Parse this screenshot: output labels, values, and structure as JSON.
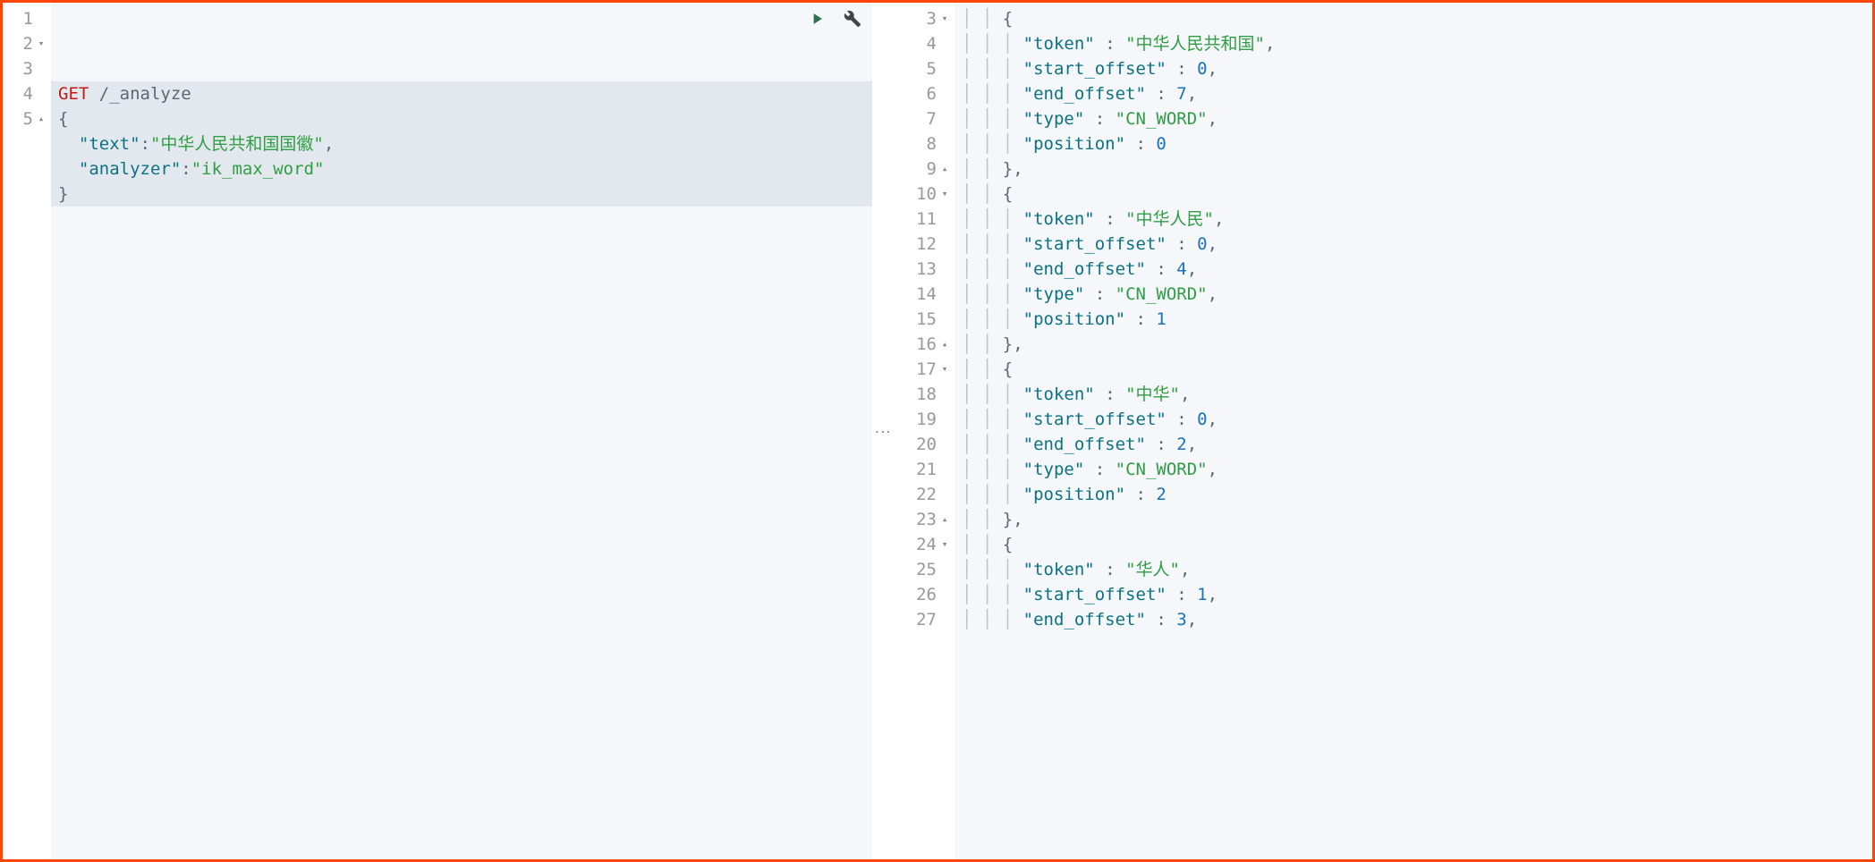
{
  "left_editor": {
    "lines": [
      {
        "n": "1",
        "fold": "",
        "segments": [
          {
            "cls": "method",
            "t": "GET"
          },
          {
            "cls": "",
            "t": " "
          },
          {
            "cls": "path",
            "t": "/_analyze"
          }
        ],
        "highlight": true
      },
      {
        "n": "2",
        "fold": "▾",
        "segments": [
          {
            "cls": "punct",
            "t": "{"
          }
        ],
        "highlight": true
      },
      {
        "n": "3",
        "fold": "",
        "segments": [
          {
            "cls": "",
            "t": "  "
          },
          {
            "cls": "key",
            "t": "\"text\""
          },
          {
            "cls": "punct",
            "t": ":"
          },
          {
            "cls": "string",
            "t": "\"中华人民共和国国徽\""
          },
          {
            "cls": "punct",
            "t": ","
          }
        ],
        "highlight": true
      },
      {
        "n": "4",
        "fold": "",
        "segments": [
          {
            "cls": "",
            "t": "  "
          },
          {
            "cls": "key",
            "t": "\"analyzer\""
          },
          {
            "cls": "punct",
            "t": ":"
          },
          {
            "cls": "string",
            "t": "\"ik_max_word\""
          }
        ],
        "highlight": true
      },
      {
        "n": "5",
        "fold": "▴",
        "segments": [
          {
            "cls": "punct",
            "t": "}"
          }
        ],
        "highlight": true
      }
    ]
  },
  "right_editor": {
    "lines": [
      {
        "n": "3",
        "fold": "▾",
        "indent": 2,
        "segments": [
          {
            "cls": "punct",
            "t": "{"
          }
        ]
      },
      {
        "n": "4",
        "fold": "",
        "indent": 3,
        "segments": [
          {
            "cls": "key",
            "t": "\"token\""
          },
          {
            "cls": "punct",
            "t": " : "
          },
          {
            "cls": "string",
            "t": "\"中华人民共和国\""
          },
          {
            "cls": "punct",
            "t": ","
          }
        ]
      },
      {
        "n": "5",
        "fold": "",
        "indent": 3,
        "segments": [
          {
            "cls": "key",
            "t": "\"start_offset\""
          },
          {
            "cls": "punct",
            "t": " : "
          },
          {
            "cls": "number",
            "t": "0"
          },
          {
            "cls": "punct",
            "t": ","
          }
        ]
      },
      {
        "n": "6",
        "fold": "",
        "indent": 3,
        "segments": [
          {
            "cls": "key",
            "t": "\"end_offset\""
          },
          {
            "cls": "punct",
            "t": " : "
          },
          {
            "cls": "number",
            "t": "7"
          },
          {
            "cls": "punct",
            "t": ","
          }
        ]
      },
      {
        "n": "7",
        "fold": "",
        "indent": 3,
        "segments": [
          {
            "cls": "key",
            "t": "\"type\""
          },
          {
            "cls": "punct",
            "t": " : "
          },
          {
            "cls": "string",
            "t": "\"CN_WORD\""
          },
          {
            "cls": "punct",
            "t": ","
          }
        ]
      },
      {
        "n": "8",
        "fold": "",
        "indent": 3,
        "segments": [
          {
            "cls": "key",
            "t": "\"position\""
          },
          {
            "cls": "punct",
            "t": " : "
          },
          {
            "cls": "number",
            "t": "0"
          }
        ]
      },
      {
        "n": "9",
        "fold": "▴",
        "indent": 2,
        "segments": [
          {
            "cls": "punct",
            "t": "},"
          }
        ]
      },
      {
        "n": "10",
        "fold": "▾",
        "indent": 2,
        "segments": [
          {
            "cls": "punct",
            "t": "{"
          }
        ]
      },
      {
        "n": "11",
        "fold": "",
        "indent": 3,
        "segments": [
          {
            "cls": "key",
            "t": "\"token\""
          },
          {
            "cls": "punct",
            "t": " : "
          },
          {
            "cls": "string",
            "t": "\"中华人民\""
          },
          {
            "cls": "punct",
            "t": ","
          }
        ]
      },
      {
        "n": "12",
        "fold": "",
        "indent": 3,
        "segments": [
          {
            "cls": "key",
            "t": "\"start_offset\""
          },
          {
            "cls": "punct",
            "t": " : "
          },
          {
            "cls": "number",
            "t": "0"
          },
          {
            "cls": "punct",
            "t": ","
          }
        ]
      },
      {
        "n": "13",
        "fold": "",
        "indent": 3,
        "segments": [
          {
            "cls": "key",
            "t": "\"end_offset\""
          },
          {
            "cls": "punct",
            "t": " : "
          },
          {
            "cls": "number",
            "t": "4"
          },
          {
            "cls": "punct",
            "t": ","
          }
        ]
      },
      {
        "n": "14",
        "fold": "",
        "indent": 3,
        "segments": [
          {
            "cls": "key",
            "t": "\"type\""
          },
          {
            "cls": "punct",
            "t": " : "
          },
          {
            "cls": "string",
            "t": "\"CN_WORD\""
          },
          {
            "cls": "punct",
            "t": ","
          }
        ]
      },
      {
        "n": "15",
        "fold": "",
        "indent": 3,
        "segments": [
          {
            "cls": "key",
            "t": "\"position\""
          },
          {
            "cls": "punct",
            "t": " : "
          },
          {
            "cls": "number",
            "t": "1"
          }
        ]
      },
      {
        "n": "16",
        "fold": "▴",
        "indent": 2,
        "segments": [
          {
            "cls": "punct",
            "t": "},"
          }
        ]
      },
      {
        "n": "17",
        "fold": "▾",
        "indent": 2,
        "segments": [
          {
            "cls": "punct",
            "t": "{"
          }
        ]
      },
      {
        "n": "18",
        "fold": "",
        "indent": 3,
        "segments": [
          {
            "cls": "key",
            "t": "\"token\""
          },
          {
            "cls": "punct",
            "t": " : "
          },
          {
            "cls": "string",
            "t": "\"中华\""
          },
          {
            "cls": "punct",
            "t": ","
          }
        ]
      },
      {
        "n": "19",
        "fold": "",
        "indent": 3,
        "segments": [
          {
            "cls": "key",
            "t": "\"start_offset\""
          },
          {
            "cls": "punct",
            "t": " : "
          },
          {
            "cls": "number",
            "t": "0"
          },
          {
            "cls": "punct",
            "t": ","
          }
        ]
      },
      {
        "n": "20",
        "fold": "",
        "indent": 3,
        "segments": [
          {
            "cls": "key",
            "t": "\"end_offset\""
          },
          {
            "cls": "punct",
            "t": " : "
          },
          {
            "cls": "number",
            "t": "2"
          },
          {
            "cls": "punct",
            "t": ","
          }
        ]
      },
      {
        "n": "21",
        "fold": "",
        "indent": 3,
        "segments": [
          {
            "cls": "key",
            "t": "\"type\""
          },
          {
            "cls": "punct",
            "t": " : "
          },
          {
            "cls": "string",
            "t": "\"CN_WORD\""
          },
          {
            "cls": "punct",
            "t": ","
          }
        ]
      },
      {
        "n": "22",
        "fold": "",
        "indent": 3,
        "segments": [
          {
            "cls": "key",
            "t": "\"position\""
          },
          {
            "cls": "punct",
            "t": " : "
          },
          {
            "cls": "number",
            "t": "2"
          }
        ]
      },
      {
        "n": "23",
        "fold": "▴",
        "indent": 2,
        "segments": [
          {
            "cls": "punct",
            "t": "},"
          }
        ]
      },
      {
        "n": "24",
        "fold": "▾",
        "indent": 2,
        "segments": [
          {
            "cls": "punct",
            "t": "{"
          }
        ]
      },
      {
        "n": "25",
        "fold": "",
        "indent": 3,
        "segments": [
          {
            "cls": "key",
            "t": "\"token\""
          },
          {
            "cls": "punct",
            "t": " : "
          },
          {
            "cls": "string",
            "t": "\"华人\""
          },
          {
            "cls": "punct",
            "t": ","
          }
        ]
      },
      {
        "n": "26",
        "fold": "",
        "indent": 3,
        "segments": [
          {
            "cls": "key",
            "t": "\"start_offset\""
          },
          {
            "cls": "punct",
            "t": " : "
          },
          {
            "cls": "number",
            "t": "1"
          },
          {
            "cls": "punct",
            "t": ","
          }
        ]
      },
      {
        "n": "27",
        "fold": "",
        "indent": 3,
        "segments": [
          {
            "cls": "key",
            "t": "\"end_offset\""
          },
          {
            "cls": "punct",
            "t": " : "
          },
          {
            "cls": "number",
            "t": "3"
          },
          {
            "cls": "punct",
            "t": ","
          }
        ]
      }
    ]
  }
}
